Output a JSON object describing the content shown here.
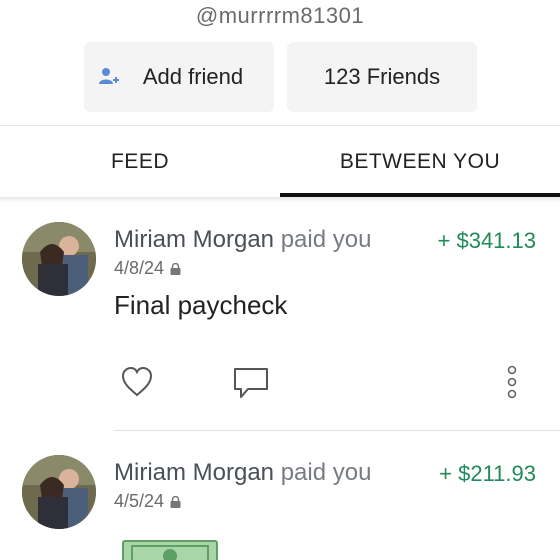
{
  "profile": {
    "username": "@murrrrm81301",
    "add_friend_label": "Add friend",
    "friends_label": "123 Friends"
  },
  "tabs": [
    {
      "label": "FEED",
      "active": false
    },
    {
      "label": "BETWEEN YOU",
      "active": true
    }
  ],
  "transactions": [
    {
      "name": "Miriam Morgan",
      "action": "paid you",
      "amount": "+ $341.13",
      "date": "4/8/24",
      "note": "Final paycheck",
      "private": true
    },
    {
      "name": "Miriam Morgan",
      "action": "paid you",
      "amount": "+ $211.93",
      "date": "4/5/24",
      "private": true
    }
  ],
  "colors": {
    "amount_positive": "#1f8a5a",
    "tab_indicator": "#111111",
    "button_bg": "#f4f4f4"
  },
  "icons": [
    "add-friend-icon",
    "lock-icon",
    "like-heart-icon",
    "comment-icon",
    "more-options-icon",
    "money-bill-icon"
  ]
}
